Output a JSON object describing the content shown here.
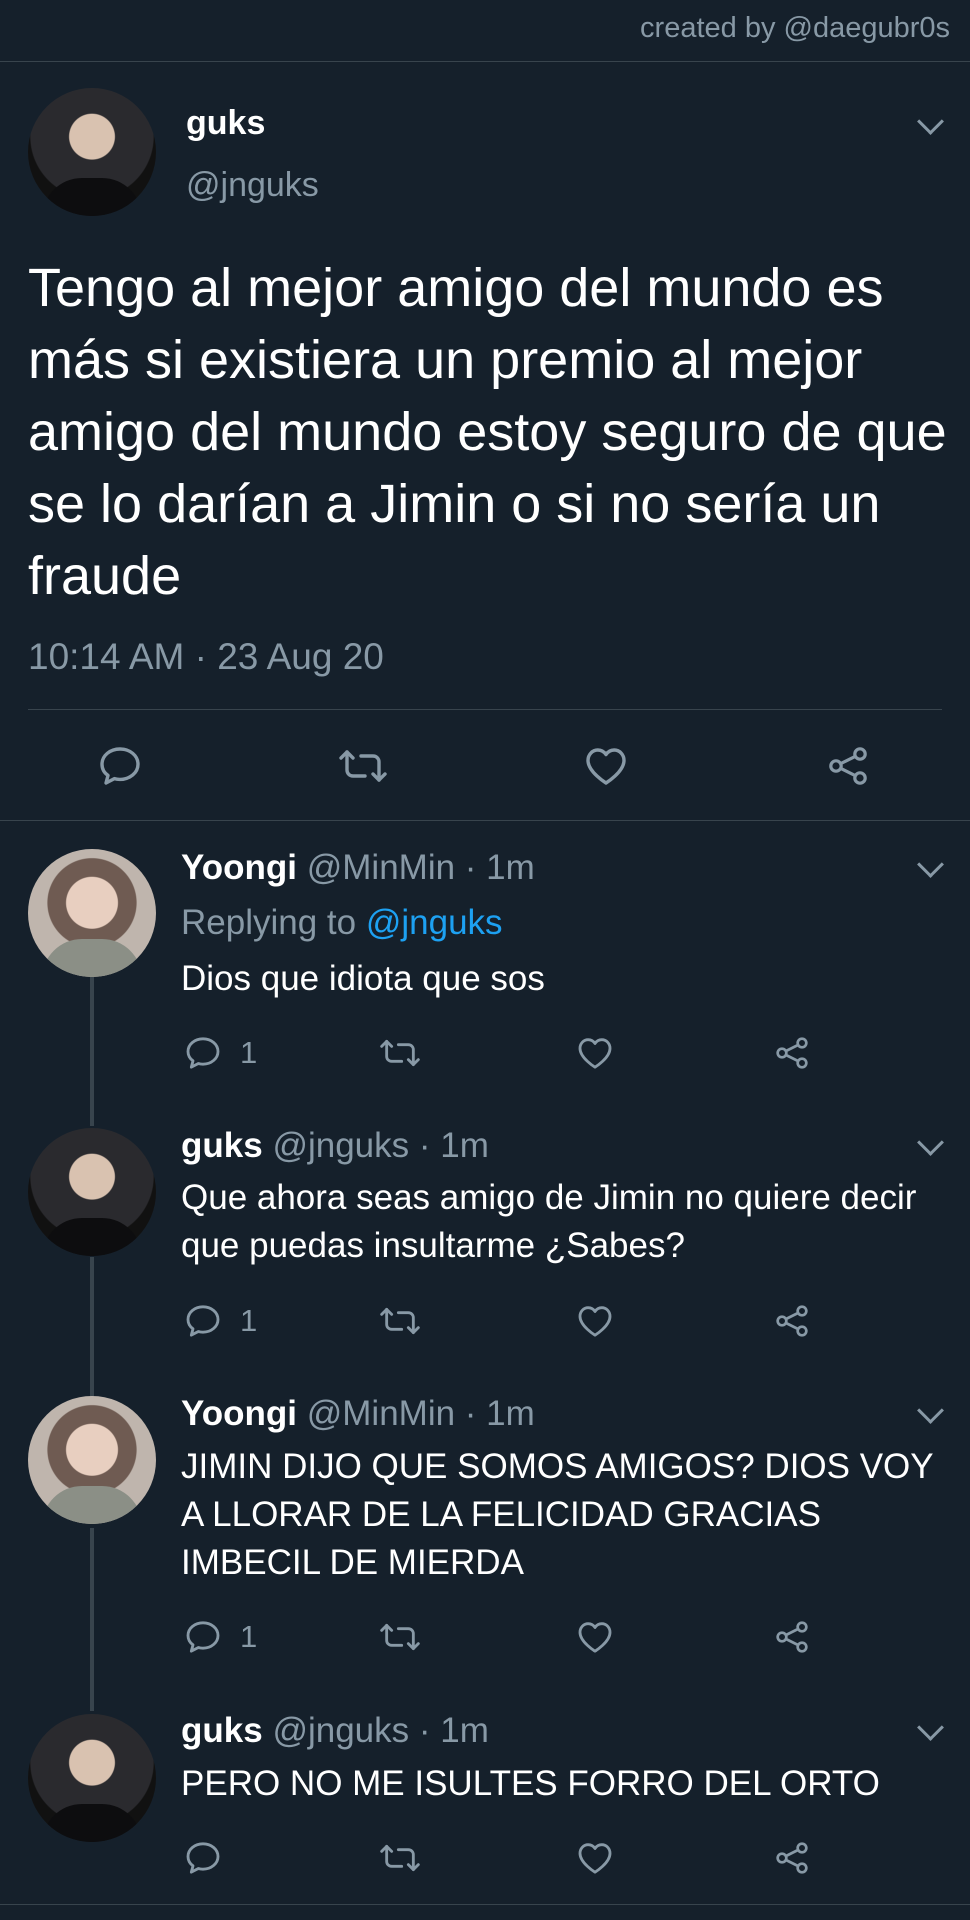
{
  "credit": "created by @daegubr0s",
  "main_tweet": {
    "name": "guks",
    "handle": "@jnguks",
    "text": "Tengo al mejor amigo del mundo es más si existiera un premio al mejor amigo del mundo estoy seguro de que se lo darían a Jimin o si no sería un fraude",
    "timestamp": "10:14 AM · 23 Aug 20"
  },
  "replies": [
    {
      "name": "Yoongi",
      "meta": "@MinMin · 1m",
      "replying_prefix": "Replying to",
      "replying_handle": "@jnguks",
      "text": "Dios que idiota que sos",
      "reply_count": "1"
    },
    {
      "name": "guks",
      "meta": "@jnguks · 1m",
      "text": "Que ahora seas amigo de Jimin no quiere decir que puedas insultarme ¿Sabes?",
      "reply_count": "1"
    },
    {
      "name": "Yoongi",
      "meta": "@MinMin · 1m",
      "text": "JIMIN DIJO QUE SOMOS AMIGOS? DIOS VOY A LLORAR DE LA FELICIDAD GRACIAS IMBECIL DE MIERDA",
      "reply_count": "1"
    },
    {
      "name": "guks",
      "meta": "@jnguks · 1m",
      "text": "PERO NO ME ISULTES FORRO DEL ORTO",
      "reply_count": ""
    }
  ],
  "icons": [
    "comment-icon",
    "retweet-icon",
    "like-icon",
    "share-icon",
    "chevron-down-icon"
  ],
  "colors": {
    "background": "#15202b",
    "secondary_text": "#8899a6",
    "link": "#1da1f2",
    "divider": "#38444d"
  }
}
